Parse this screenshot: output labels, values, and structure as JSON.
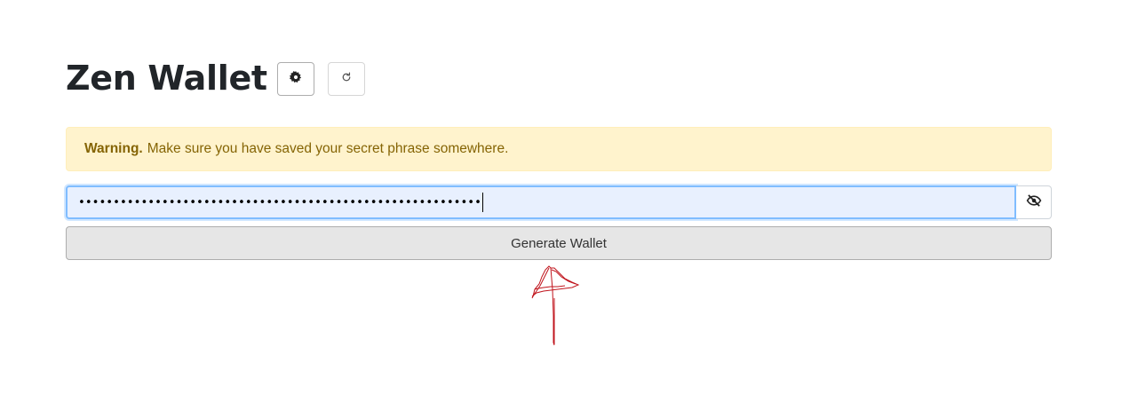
{
  "header": {
    "title": "Zen Wallet",
    "settings_icon": "gear-icon",
    "refresh_icon": "refresh-icon"
  },
  "alert": {
    "label": "Warning.",
    "message": "Make sure you have saved your secret phrase somewhere."
  },
  "secret_input": {
    "masked_value": "••••••••••••••••••••••••••••••••••••••••••••••••••••••••••",
    "visibility_icon": "eye-slash-icon"
  },
  "generate_button": {
    "label": "Generate Wallet"
  },
  "colors": {
    "alert_bg": "#fff3cd",
    "alert_text": "#856404",
    "input_bg": "#e8f0fe",
    "input_focus_border": "#80bdff",
    "button_bg": "#e6e6e6",
    "annotation_stroke": "#c0141c"
  }
}
